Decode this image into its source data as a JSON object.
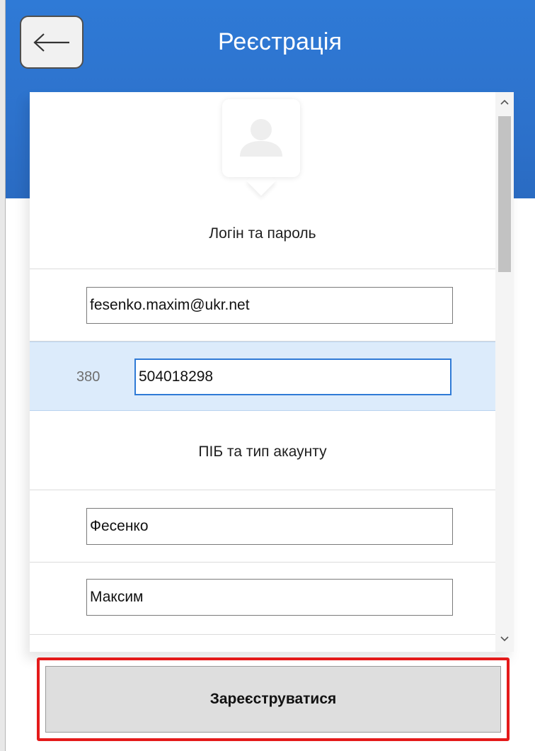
{
  "header": {
    "title": "Реєстрація",
    "back_icon": "arrow-left-icon",
    "color": "#2f7ad6"
  },
  "form": {
    "avatar_icon": "user-avatar-icon",
    "section_login": "Логін та пароль",
    "email_value": "fesenko.maxim@ukr.net",
    "phone_prefix": "380",
    "phone_value": "504018298",
    "section_name": "ПІБ та тип акаунту",
    "last_name_value": "Фесенко",
    "first_name_value": "Максим"
  },
  "scrollbar": {
    "up_icon": "chevron-up-icon",
    "down_icon": "chevron-down-icon"
  },
  "actions": {
    "register_label": "Зареєструватися",
    "highlight_color": "#e41a1a"
  }
}
